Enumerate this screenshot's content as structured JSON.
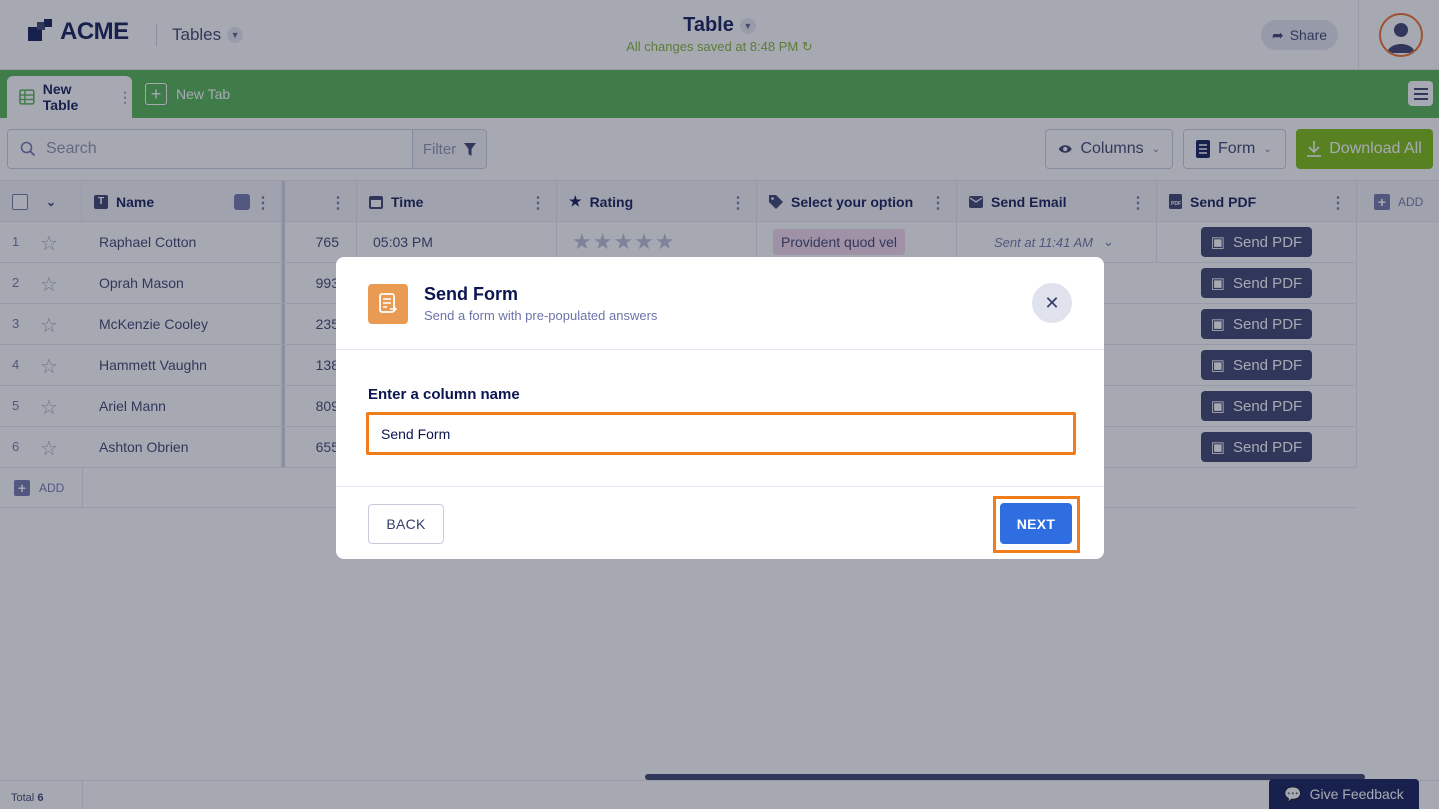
{
  "header": {
    "logo_text": "ACME",
    "tables_label": "Tables",
    "doc_title": "Table",
    "save_status": "All changes saved at 8:48 PM",
    "share_label": "Share"
  },
  "tabs": {
    "active_label": "New Table",
    "new_tab_label": "New Tab"
  },
  "toolbar": {
    "search_placeholder": "Search",
    "filter_label": "Filter",
    "columns_label": "Columns",
    "form_label": "Form",
    "download_label": "Download All"
  },
  "table": {
    "columns": {
      "name": "Name",
      "time": "Time",
      "rating": "Rating",
      "select": "Select your option",
      "send_email": "Send Email",
      "send_pdf": "Send PDF"
    },
    "add_column_label": "ADD",
    "add_row_label": "ADD",
    "rows": [
      {
        "num": "1",
        "name": "Raphael Cotton",
        "number": "765",
        "time": "05:03 PM",
        "option": "Provident quod vel",
        "email_status": "Sent at 11:41 AM",
        "pdf": "Send PDF"
      },
      {
        "num": "2",
        "name": "Oprah Mason",
        "number": "993",
        "pdf": "Send PDF"
      },
      {
        "num": "3",
        "name": "McKenzie Cooley",
        "number": "235",
        "pdf": "Send PDF"
      },
      {
        "num": "4",
        "name": "Hammett Vaughn",
        "number": "138",
        "pdf": "Send PDF"
      },
      {
        "num": "5",
        "name": "Ariel Mann",
        "number": "809",
        "pdf": "Send PDF"
      },
      {
        "num": "6",
        "name": "Ashton Obrien",
        "number": "655",
        "pdf": "Send PDF"
      }
    ]
  },
  "footer": {
    "total_label": "Total",
    "total_count": "6",
    "feedback_label": "Give Feedback"
  },
  "modal": {
    "title": "Send Form",
    "subtitle": "Send a form with pre-populated answers",
    "field_label": "Enter a column name",
    "field_value": "Send Form",
    "back_label": "BACK",
    "next_label": "NEXT"
  },
  "colors": {
    "tabbar": "#4db24c",
    "download": "#78bb07",
    "navy": "#0a1551",
    "next": "#2e6ee0",
    "highlight": "#f07d19",
    "modal_icon": "#e99b54"
  }
}
